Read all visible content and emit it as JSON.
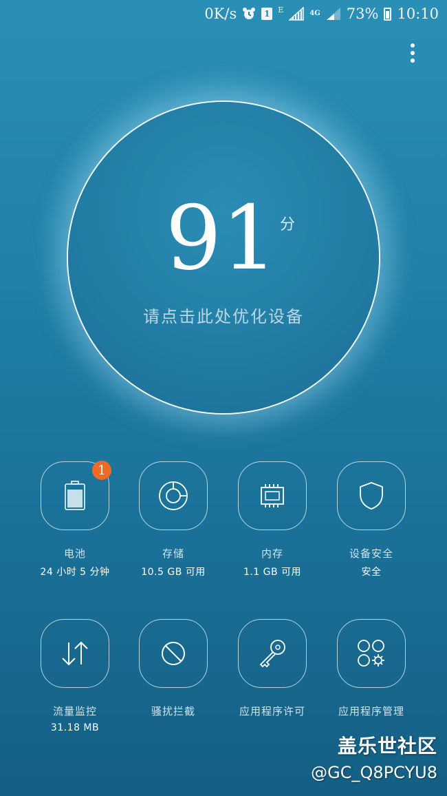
{
  "status_bar": {
    "speed": "0K/s",
    "alarm_icon": "alarm-clock-icon",
    "sim_label": "1",
    "network_e": "E",
    "network_4g": "4G",
    "battery_percent": "73%",
    "time": "10:10"
  },
  "score": {
    "value": "91",
    "unit": "分",
    "hint": "请点击此处优化设备"
  },
  "tiles": [
    {
      "icon": "battery-icon",
      "label": "电池",
      "sub": "24 小时 5 分钟",
      "badge": "1"
    },
    {
      "icon": "storage-icon",
      "label": "存储",
      "sub": "10.5 GB 可用"
    },
    {
      "icon": "memory-chip-icon",
      "label": "内存",
      "sub": "1.1 GB 可用"
    },
    {
      "icon": "shield-icon",
      "label": "设备安全",
      "sub": "安全"
    },
    {
      "icon": "data-transfer-icon",
      "label": "流量监控",
      "sub": "31.18 MB"
    },
    {
      "icon": "block-icon",
      "label": "骚扰拦截",
      "sub": ""
    },
    {
      "icon": "key-icon",
      "label": "应用程序许可",
      "sub": ""
    },
    {
      "icon": "app-manager-icon",
      "label": "应用程序管理",
      "sub": ""
    }
  ],
  "watermark": {
    "title": "盖乐世社区",
    "user": "@GC_Q8PCYU8"
  },
  "colors": {
    "accent_badge": "#f06a22",
    "background_top": "#2a8fb6",
    "background_bottom": "#145f84"
  }
}
